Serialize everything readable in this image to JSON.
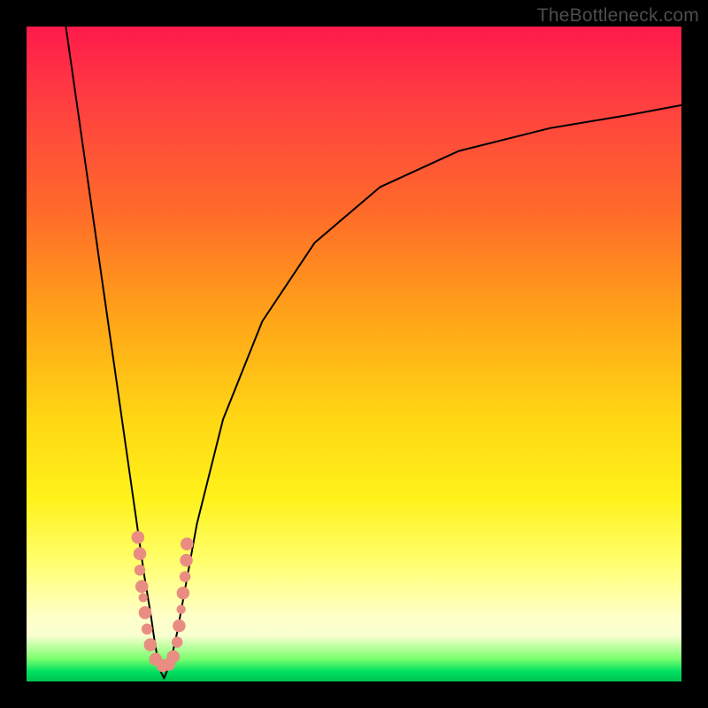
{
  "watermark": {
    "text": "TheBottleneck.com"
  },
  "colors": {
    "curve": "#000000",
    "marker_fill": "#e98d82",
    "marker_stroke": "#d4776e",
    "frame": "#000000"
  },
  "chart_data": {
    "type": "line",
    "title": "",
    "xlabel": "",
    "ylabel": "",
    "xlim": [
      0,
      100
    ],
    "ylim": [
      0,
      100
    ],
    "left_curve_desc": "steep descending curve from top-left to a cusp near x≈20 at y≈0",
    "right_curve_desc": "curve rising from same cusp asymptotically toward ~y≈88 at right edge",
    "series": [
      {
        "name": "left",
        "x": [
          6,
          8,
          10,
          12,
          14,
          16,
          17,
          18,
          19,
          19.5,
          20,
          20.5,
          21
        ],
        "y": [
          100,
          86,
          72,
          58,
          44,
          30,
          23,
          16,
          10,
          6.5,
          3.5,
          1.5,
          0.5
        ]
      },
      {
        "name": "right",
        "x": [
          21,
          22,
          23,
          24,
          26,
          30,
          36,
          44,
          54,
          66,
          80,
          92,
          100
        ],
        "y": [
          0.5,
          3,
          7.5,
          13,
          24,
          40,
          55,
          67,
          75.5,
          81,
          84.5,
          86.5,
          88
        ]
      }
    ],
    "markers_desc": "two short vertical clusters of salmon-coloured scatter points flanking the cusp, roughly between y≈3 and y≈22",
    "markers": [
      {
        "x": 17.0,
        "y": 22.0,
        "r": 1.4
      },
      {
        "x": 17.3,
        "y": 19.5,
        "r": 1.4
      },
      {
        "x": 17.3,
        "y": 17.0,
        "r": 1.2
      },
      {
        "x": 17.6,
        "y": 14.5,
        "r": 1.4
      },
      {
        "x": 17.8,
        "y": 12.8,
        "r": 1.0
      },
      {
        "x": 18.1,
        "y": 10.5,
        "r": 1.4
      },
      {
        "x": 18.4,
        "y": 8.0,
        "r": 1.2
      },
      {
        "x": 18.9,
        "y": 5.6,
        "r": 1.4
      },
      {
        "x": 19.7,
        "y": 3.4,
        "r": 1.4
      },
      {
        "x": 20.8,
        "y": 2.4,
        "r": 1.4
      },
      {
        "x": 21.7,
        "y": 2.6,
        "r": 1.4
      },
      {
        "x": 22.4,
        "y": 3.8,
        "r": 1.4
      },
      {
        "x": 23.0,
        "y": 6.0,
        "r": 1.2
      },
      {
        "x": 23.3,
        "y": 8.5,
        "r": 1.4
      },
      {
        "x": 23.6,
        "y": 11.0,
        "r": 1.0
      },
      {
        "x": 23.9,
        "y": 13.5,
        "r": 1.4
      },
      {
        "x": 24.2,
        "y": 16.0,
        "r": 1.2
      },
      {
        "x": 24.4,
        "y": 18.5,
        "r": 1.4
      },
      {
        "x": 24.5,
        "y": 21.0,
        "r": 1.4
      }
    ]
  }
}
